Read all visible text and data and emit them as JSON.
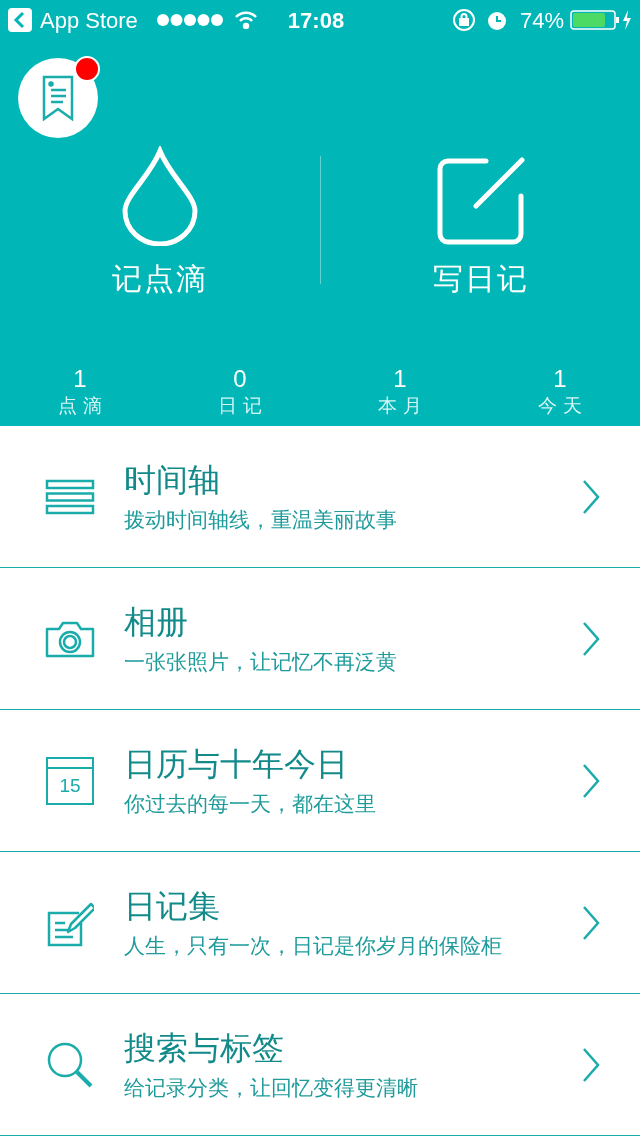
{
  "status_bar": {
    "back_label": "App Store",
    "time": "17:08",
    "battery": "74%"
  },
  "header": {
    "has_notification": true,
    "actions": [
      {
        "kind": "drop",
        "label": "记点滴"
      },
      {
        "kind": "edit",
        "label": "写日记"
      }
    ],
    "stats": [
      {
        "value": "1",
        "label": "点 滴"
      },
      {
        "value": "0",
        "label": "日 记"
      },
      {
        "value": "1",
        "label": "本 月"
      },
      {
        "value": "1",
        "label": "今 天"
      }
    ]
  },
  "menu": [
    {
      "kind": "timeline",
      "title": "时间轴",
      "subtitle": "拨动时间轴线，重温美丽故事"
    },
    {
      "kind": "camera",
      "title": "相册",
      "subtitle": "一张张照片，让记忆不再泛黄"
    },
    {
      "kind": "calendar",
      "title": "日历与十年今日",
      "subtitle": "你过去的每一天，都在这里",
      "icon_text": "15"
    },
    {
      "kind": "diary",
      "title": "日记集",
      "subtitle": "人生，只有一次，日记是你岁月的保险柜"
    },
    {
      "kind": "search",
      "title": "搜索与标签",
      "subtitle": "给记录分类，让回忆变得更清晰"
    }
  ]
}
